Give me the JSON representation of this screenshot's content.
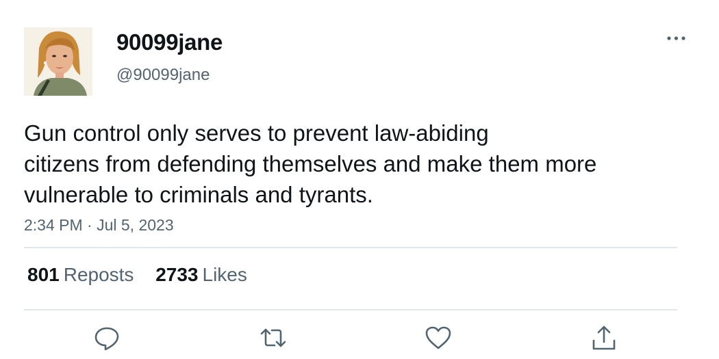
{
  "tweet": {
    "author": {
      "display_name": "90099jane",
      "handle": "@90099jane"
    },
    "text_lines": [
      "Gun control only serves to prevent law-abiding",
      "citizens from defending themselves and make them more",
      "vulnerable to criminals and tyrants."
    ],
    "timestamp": "2:34 PM · Jul 5, 2023",
    "stats": {
      "reposts_count": "801",
      "reposts_label": "Reposts",
      "likes_count": "2733",
      "likes_label": "Likes"
    }
  },
  "icons": {
    "more": "more-horizontal-icon",
    "reply": "reply-icon",
    "repost": "repost-icon",
    "like": "heart-icon",
    "share": "share-icon"
  },
  "colors": {
    "primary_text": "#0f1419",
    "secondary_text": "#536471",
    "divider": "#e1e6ea"
  }
}
